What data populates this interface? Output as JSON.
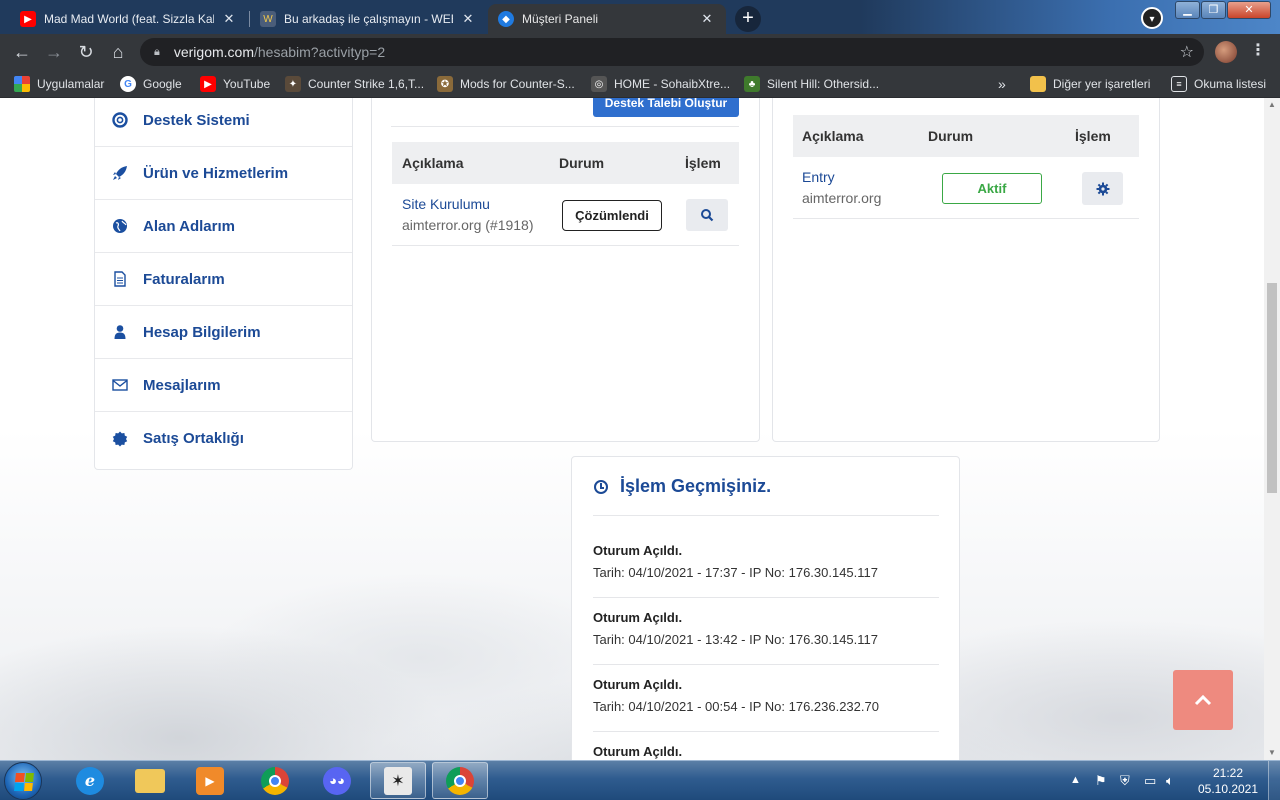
{
  "browser": {
    "tabs": [
      {
        "title": "Mad Mad World (feat. Sizzla Kalonji",
        "icon": "youtube-icon",
        "active": false
      },
      {
        "title": "Bu arkadaş ile çalışmayın - WEBA",
        "icon": "webmaster-icon",
        "active": false
      },
      {
        "title": "Müşteri Paneli",
        "icon": "site-icon",
        "active": true
      }
    ],
    "new_tab": "+",
    "address": {
      "host": "verigom.com",
      "path": "/hesabim?activityp=2"
    },
    "bookmarks": [
      {
        "label": "Uygulamalar",
        "icon": "apps-grid-icon"
      },
      {
        "label": "Google",
        "icon": "google-icon"
      },
      {
        "label": "YouTube",
        "icon": "youtube-icon"
      },
      {
        "label": "Counter Strike 1,6,T...",
        "icon": "cs-icon"
      },
      {
        "label": "Mods for Counter-S...",
        "icon": "mods-icon"
      },
      {
        "label": "HOME - SohaibXtre...",
        "icon": "sohaib-icon"
      },
      {
        "label": "Silent Hill: Othersid...",
        "icon": "silenthill-icon"
      }
    ],
    "bookmarks_overflow": "»",
    "other_bookmarks": "Diğer yer işaretleri",
    "reading_list": "Okuma listesi"
  },
  "sidebar": {
    "items": [
      {
        "label": "Destek Sistemi",
        "icon": "lifebuoy-icon"
      },
      {
        "label": "Ürün ve Hizmetlerim",
        "icon": "rocket-icon"
      },
      {
        "label": "Alan Adlarım",
        "icon": "globe-icon"
      },
      {
        "label": "Faturalarım",
        "icon": "invoice-icon"
      },
      {
        "label": "Hesap Bilgilerim",
        "icon": "user-icon"
      },
      {
        "label": "Mesajlarım",
        "icon": "envelope-icon"
      },
      {
        "label": "Satış Ortaklığı",
        "icon": "badge-icon"
      }
    ]
  },
  "support": {
    "create_button": "Destek Talebi Oluştur",
    "columns": [
      "Açıklama",
      "Durum",
      "İşlem"
    ],
    "rows": [
      {
        "title": "Site Kurulumu",
        "subtitle": "aimterror.org (#1918)",
        "status": "Çözümlendi",
        "action_icon": "search-icon"
      }
    ]
  },
  "services": {
    "columns": [
      "Açıklama",
      "Durum",
      "İşlem"
    ],
    "rows": [
      {
        "title": "Entry",
        "subtitle": "aimterror.org",
        "status": "Aktif",
        "action_icon": "gear-icon"
      }
    ]
  },
  "history": {
    "title": "İşlem Geçmişiniz.",
    "items": [
      {
        "event": "Oturum Açıldı.",
        "detail": "Tarih: 04/10/2021 - 17:37 - IP No: 176.30.145.117"
      },
      {
        "event": "Oturum Açıldı.",
        "detail": "Tarih: 04/10/2021 - 13:42 - IP No: 176.30.145.117"
      },
      {
        "event": "Oturum Açıldı.",
        "detail": "Tarih: 04/10/2021 - 00:54 - IP No: 176.236.232.70"
      },
      {
        "event": "Oturum Açıldı.",
        "detail": ""
      }
    ]
  },
  "taskbar": {
    "apps": [
      "internet-explorer-icon",
      "file-explorer-icon",
      "media-player-icon",
      "chrome-icon",
      "discord-icon",
      "counter-strike-icon",
      "chrome-active-icon"
    ],
    "time": "21:22",
    "date": "05.10.2021"
  },
  "colors": {
    "accent": "#1c4a96",
    "button_blue": "#2f6fce",
    "success": "#3aa845",
    "scroll_top": "#ee8a7f"
  }
}
